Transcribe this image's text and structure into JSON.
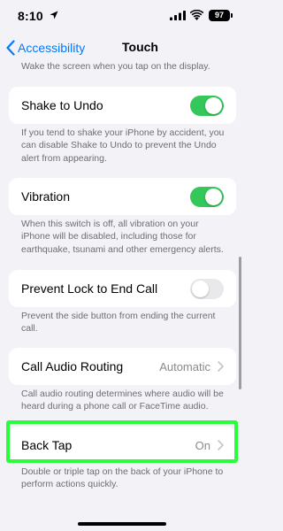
{
  "status_bar": {
    "time": "8:10",
    "battery": "97",
    "icons": [
      "location-arrow-icon",
      "signal-icon",
      "wifi-icon",
      "battery-icon"
    ]
  },
  "nav": {
    "back_label": "Accessibility",
    "title": "Touch"
  },
  "sections": {
    "tap_to_wake_footer": "Wake the screen when you tap on the display.",
    "shake_to_undo": {
      "label": "Shake to Undo",
      "enabled": true,
      "footer": "If you tend to shake your iPhone by accident, you can disable Shake to Undo to prevent the Undo alert from appearing."
    },
    "vibration": {
      "label": "Vibration",
      "enabled": true,
      "footer": "When this switch is off, all vibration on your iPhone will be disabled, including those for earthquake, tsunami and other emergency alerts."
    },
    "prevent_lock": {
      "label": "Prevent Lock to End Call",
      "enabled": false,
      "footer": "Prevent the side button from ending the current call."
    },
    "call_audio_routing": {
      "label": "Call Audio Routing",
      "value": "Automatic",
      "footer": "Call audio routing determines where audio will be heard during a phone call or FaceTime audio."
    },
    "back_tap": {
      "label": "Back Tap",
      "value": "On",
      "footer": "Double or triple tap on the back of your iPhone to perform actions quickly."
    }
  },
  "colors": {
    "accent": "#007aff",
    "toggle_on": "#34c759",
    "toggle_off": "#e9e9eb",
    "highlight": "#26ff3a",
    "background": "#f2f2f7"
  }
}
